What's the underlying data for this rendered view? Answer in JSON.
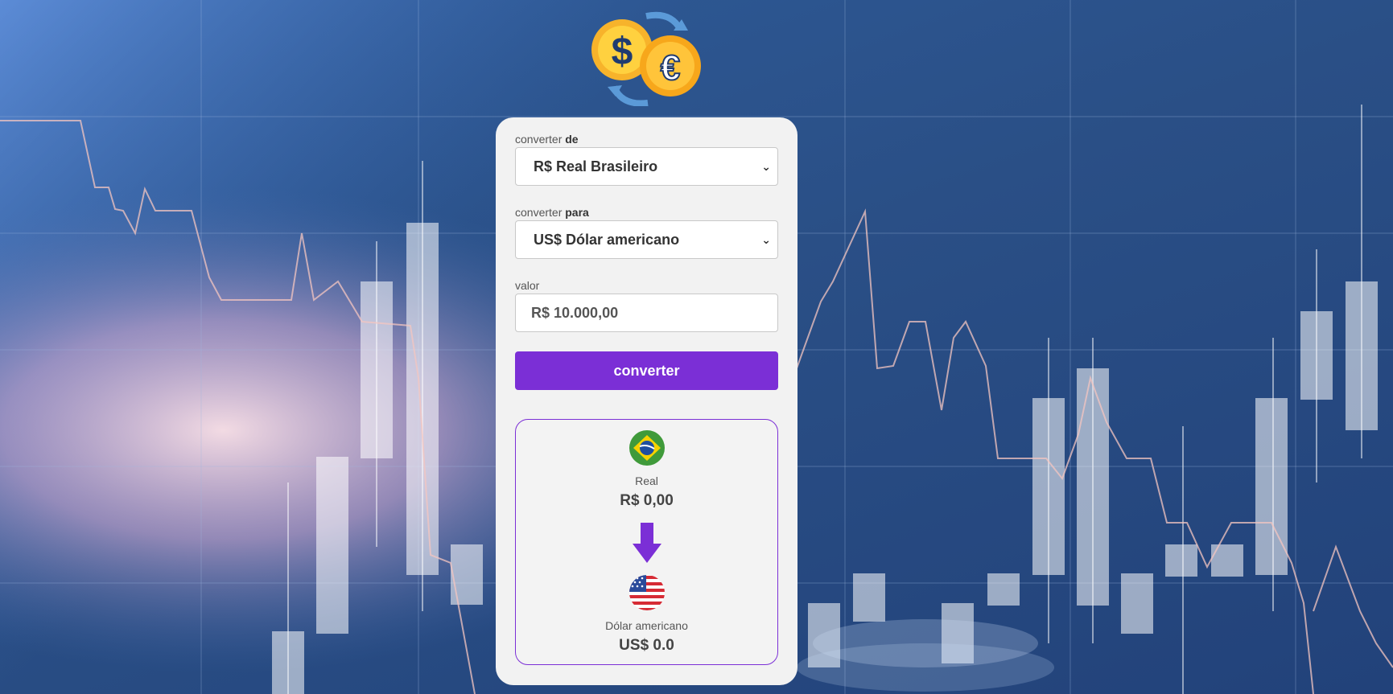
{
  "app": {
    "background": "#2a4f86",
    "accent": "#7b2fd6",
    "logo_icon": "currency-exchange-icon"
  },
  "form": {
    "from": {
      "label_prefix": "converter",
      "label_emph": "de",
      "selected": "R$ Real Brasileiro"
    },
    "to": {
      "label_prefix": "converter",
      "label_emph": "para",
      "selected": "US$ Dólar americano"
    },
    "amount": {
      "label": "valor",
      "placeholder": "R$ 10.000,00"
    },
    "submit_label": "converter"
  },
  "result": {
    "from": {
      "flag_icon": "brazil-flag-icon",
      "name": "Real",
      "value": "R$ 0,00"
    },
    "arrow_icon": "arrow-down-icon",
    "to": {
      "flag_icon": "usa-flag-icon",
      "name": "Dólar americano",
      "value": "US$ 0.0"
    }
  }
}
